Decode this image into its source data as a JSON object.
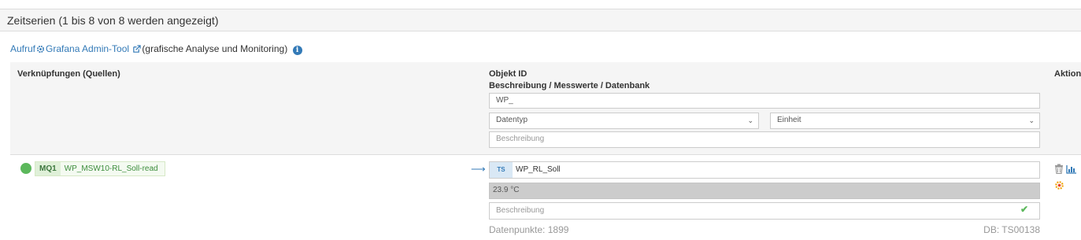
{
  "panel": {
    "title": "Zeitserien (1 bis 8 von 8 werden angezeigt)"
  },
  "grafana": {
    "prefix": "Aufruf",
    "link_label": "Grafana Admin-Tool",
    "suffix": "(grafische Analyse und Monitoring)"
  },
  "table": {
    "header": {
      "col_sources": "Verknüpfungen (Quellen)",
      "col_object_id": "Objekt ID",
      "col_description": "Beschreibung / Messwerte / Datenbank",
      "col_actions": "Aktion"
    },
    "filters": {
      "object_id_value": "WP_",
      "datatype_selected": "Datentyp",
      "unit_selected": "Einheit",
      "description_placeholder": "Beschreibung"
    },
    "rows": [
      {
        "source_badge": "MQ1",
        "source_name": "WP_MSW10-RL_Soll-read",
        "status_color": "#5cb85c",
        "type_badge": "TS",
        "object_name": "WP_RL_Soll",
        "value": "23.9 °C",
        "description_placeholder": "Beschreibung",
        "datapoints_text": "Datenpunkte: 1899",
        "db_text": "DB: TS00138"
      }
    ]
  },
  "colors": {
    "link": "#337ab7",
    "success": "#5cb85c",
    "header_bg": "#f5f5f5"
  },
  "icons": [
    "gear-icon",
    "external-link-icon",
    "info-icon",
    "arrow-right-icon",
    "check-icon",
    "trash-icon",
    "chart-icon",
    "settings-icon"
  ]
}
